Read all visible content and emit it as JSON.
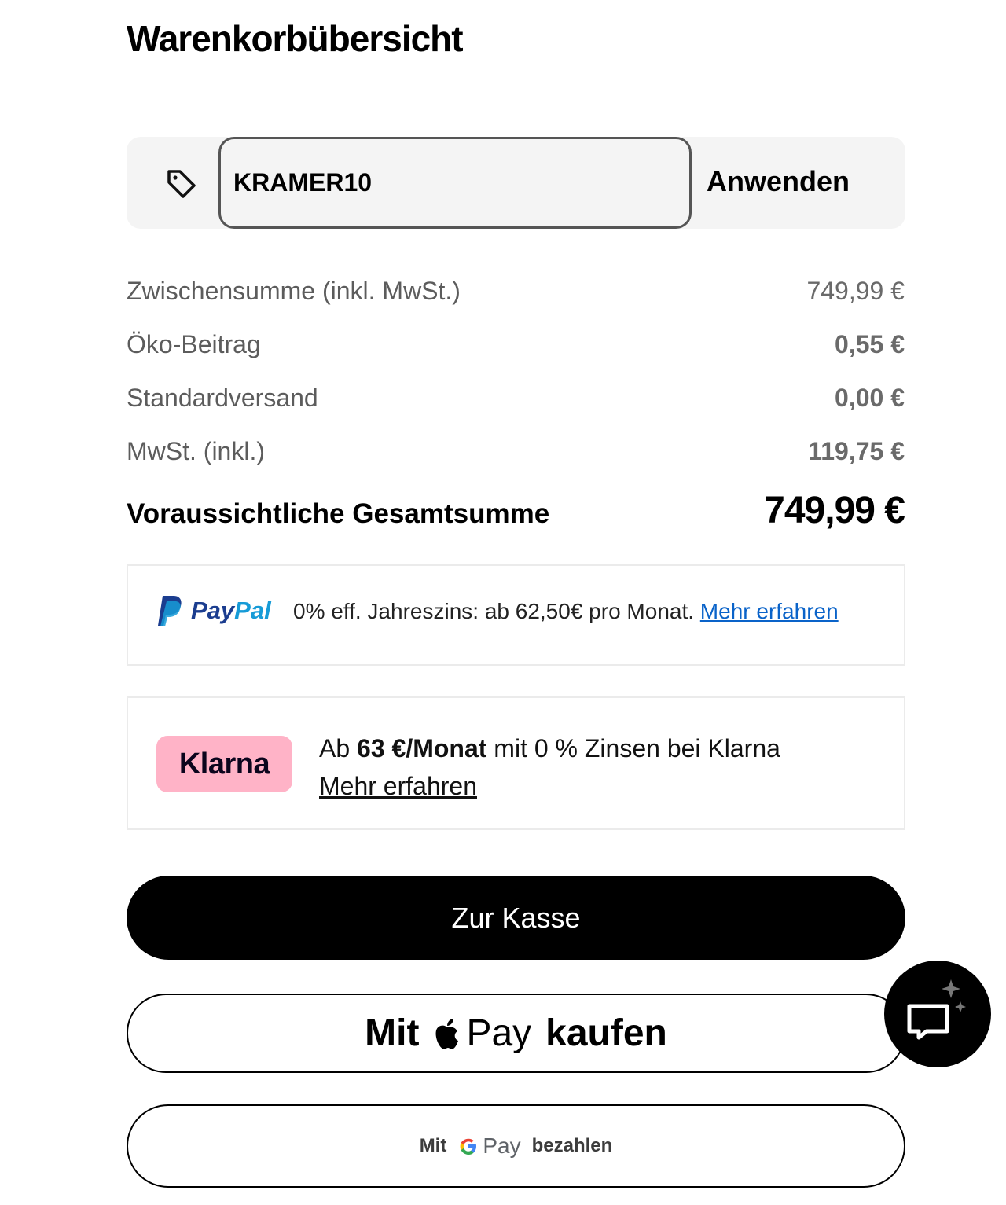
{
  "header": {
    "title": "Warenkorbübersicht"
  },
  "promo": {
    "icon": "tag-icon",
    "code_value": "KRAMER10",
    "apply_label": "Anwenden"
  },
  "summary": {
    "rows": [
      {
        "label": "Zwischensumme (inkl. MwSt.)",
        "value": "749,99 €"
      },
      {
        "label": "Öko-Beitrag",
        "value": "0,55 €"
      },
      {
        "label": "Standardversand",
        "value": "0,00 €"
      },
      {
        "label": "MwSt. (inkl.)",
        "value": "119,75 €"
      }
    ],
    "total": {
      "label": "Voraussichtliche Gesamtsumme",
      "value": "749,99 €"
    }
  },
  "paypal": {
    "logo_text_a": "Pay",
    "logo_text_b": "Pal",
    "text": "0% eff. Jahreszins: ab 62,50€ pro Monat.",
    "link": "Mehr erfahren"
  },
  "klarna": {
    "badge": "Klarna",
    "text_pre": "Ab",
    "text_bold": "63 €/Monat",
    "text_post": "mit 0 % Zinsen bei Klarna",
    "link": "Mehr erfahren"
  },
  "buttons": {
    "checkout": "Zur Kasse",
    "applepay_pre": "Mit",
    "applepay_pay": "Pay",
    "applepay_post": "kaufen",
    "googlepay_pre": "Mit",
    "googlepay_pay": "Pay",
    "googlepay_post": "bezahlen"
  },
  "chat": {
    "icon": "chat-sparkle-icon"
  },
  "colors": {
    "klarna_pink": "#ffb3c7",
    "paypal_dark_blue": "#1b3d8f",
    "paypal_light_blue": "#169bd7",
    "link_blue": "#0a63c9"
  }
}
